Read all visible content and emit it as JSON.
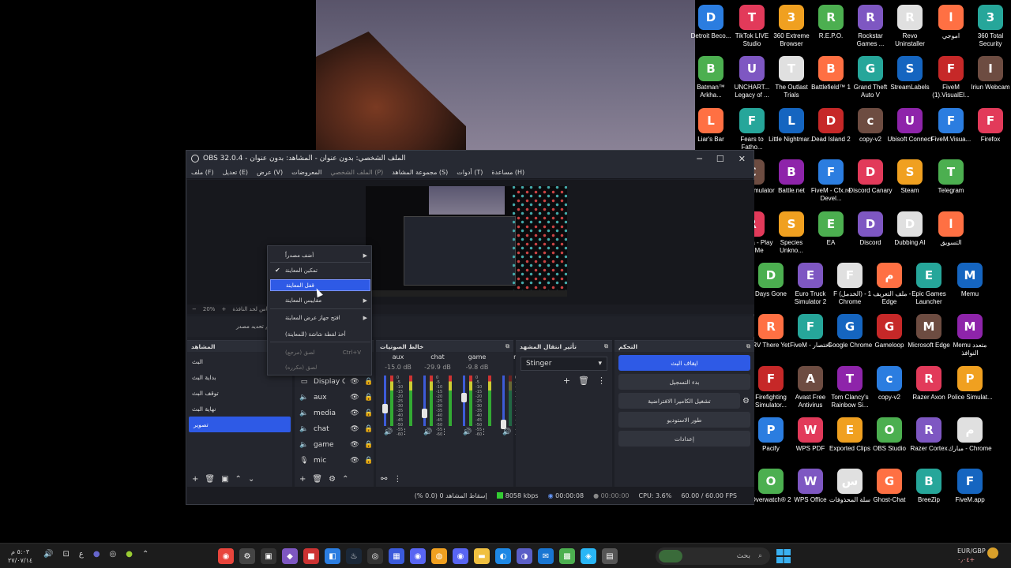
{
  "window": {
    "title": "OBS 32.0.4 - الملف الشخصي: بدون عنوان - المشاهد: بدون عنوان",
    "controls": [
      "─",
      "☐",
      "✕"
    ]
  },
  "menu": [
    {
      "label": "ملف (F)",
      "dim": false
    },
    {
      "label": "تعديل (E)",
      "dim": false
    },
    {
      "label": "عرض (V)",
      "dim": false
    },
    {
      "label": "المعروضات",
      "dim": false
    },
    {
      "label": "الملف الشخصي (P)",
      "dim": true
    },
    {
      "label": "مجموعة المشاهد (S)",
      "dim": false
    },
    {
      "label": "أدوات (T)",
      "dim": false
    },
    {
      "label": "مساعدة (H)",
      "dim": false
    }
  ],
  "zoombar": {
    "minus": "−",
    "zoom": "20%",
    "plus": "+",
    "fit": "قياس لحد النافذة"
  },
  "sourcebar_hint": "لم يتم تحديد مصدر",
  "scenes": {
    "title": "المشاهد",
    "items": [
      "البث",
      "بداية البث",
      "توقف البث",
      "نهاية البث",
      "تصوير"
    ],
    "selected_index": 4
  },
  "sources": {
    "items": [
      {
        "name": "Display Ca",
        "icon": "monitor-icon"
      },
      {
        "name": "aux",
        "icon": "speaker-icon"
      },
      {
        "name": "media",
        "icon": "speaker-icon"
      },
      {
        "name": "chat",
        "icon": "speaker-icon"
      },
      {
        "name": "game",
        "icon": "speaker-icon"
      },
      {
        "name": "mic",
        "icon": "microphone-icon"
      }
    ]
  },
  "mixer": {
    "title": "خالط الصوتيات",
    "channels": [
      {
        "name": "aux",
        "db": "-15.0 dB",
        "level": 0.35
      },
      {
        "name": "chat",
        "db": "-29.9 dB",
        "level": 0.25
      },
      {
        "name": "game",
        "db": "-9.8 dB",
        "level": 0.6
      },
      {
        "name": "m",
        "db": "",
        "level": 0.0
      }
    ],
    "scale": [
      "0",
      "-5",
      "-10",
      "-15",
      "-20",
      "-25",
      "-30",
      "-35",
      "-40",
      "-45",
      "-50",
      "-55",
      "-60"
    ]
  },
  "transitions": {
    "title": "تأثير انتقال المشهد",
    "selected": "Stinger"
  },
  "controls": {
    "title": "التحكم",
    "buttons": [
      "ايقاف البث",
      "بدء التسجيل",
      "تشغيل الكاميرا الافتراضية",
      "طور الاستوديو",
      "إعدادات"
    ]
  },
  "status": {
    "dropped": "إسقاط المشاهد 0 (0.0 %)",
    "bitrate": "8058 kbps",
    "stream_time": "00:00:08",
    "rec_time": "00:00:00",
    "cpu": "CPU: 3.6%",
    "fps": "60.00 / 60.00 FPS"
  },
  "context_menu": {
    "items": [
      {
        "label": "أضف مصدراً",
        "submenu": true
      },
      {
        "label": "تمكين المعاينة",
        "checked": true
      },
      {
        "label": "قفل المعاينة",
        "selected": true
      },
      {
        "label": "مقاييس المعاينة",
        "submenu": true
      },
      {
        "label": "افتح جهاز عرض المعاينة",
        "submenu": true
      },
      {
        "label": "أخذ لقطة شاشة (للمعاينة)"
      },
      {
        "label": "لصق (مرجع)",
        "shortcut": "Ctrl+V",
        "disabled": true
      },
      {
        "label": "لصق (مكرره)",
        "disabled": true
      }
    ]
  },
  "desktop_icons": [
    [
      "Detroit Beco...",
      "TikTok LIVE Studio",
      "360 Extreme Browser",
      "R.E.P.O.",
      "Rockstar Games ...",
      "Revo Uninstaller",
      "اموجي",
      "360 Total Security"
    ],
    [
      "Batman™ Arkha...",
      "UNCHART... Legacy of ...",
      "The Outlast Trials",
      "Battlefield™ 1",
      "Grand Theft Auto V",
      "StreamLabels",
      "FiveM (1).VisualEl...",
      "Iriun Webcam"
    ],
    [
      "Liar's Bar",
      "Fears to Fatho...",
      "Little Nightmar...",
      "Dead Island 2",
      "copy-v2",
      "Ubisoft Connect",
      "FiveM.Visua...",
      "Firefox"
    ],
    [
      "",
      "Crime Simulator",
      "Battle.net",
      "FiveM - Cfx.re Devel...",
      "Discord Canary",
      "Steam",
      "Telegram",
      ""
    ],
    [
      "",
      "Ramona - Play With Me",
      "Species Unkno...",
      "EA",
      "Discord",
      "Dubbing AI",
      "التسويق",
      ""
    ],
    [
      "Days Gone",
      "Euro Truck Simulator 2",
      "F (الخدمل) - Chrome",
      "ملف التعريف 1 - Edge",
      "Epic Games Launcher",
      "Memu",
      "",
      ""
    ],
    [
      "RV There Yet",
      "FiveM - اختصار",
      "Google Chrome",
      "Gameloop",
      "Microsoft Edge",
      "Memu متعدد النوافذ",
      "",
      ""
    ],
    [
      "Firefighting Simulator...",
      "Avast Free Antivirus",
      "Tom Clancy's Rainbow Si...",
      "copy-v2",
      "Razer Axon",
      "Police Simulat...",
      "",
      ""
    ],
    [
      "Pacify",
      "WPS PDF",
      "Exported Clips",
      "OBS Studio",
      "Razer Cortex",
      "مبارك - Chrome",
      "",
      ""
    ],
    [
      "Overwatch® 2",
      "WPS Office",
      "سلة المحذوفات",
      "Ghost-Chat",
      "BreeZip",
      "FiveM.app",
      "",
      ""
    ]
  ],
  "taskbar": {
    "time": "٥:٠٣ م",
    "date": "٢٧/٠٧/١٤",
    "lang": "ع",
    "search_placeholder": "بحث",
    "fx_label": "EUR/GBP",
    "fx_value": "٠٫٠٤+"
  }
}
